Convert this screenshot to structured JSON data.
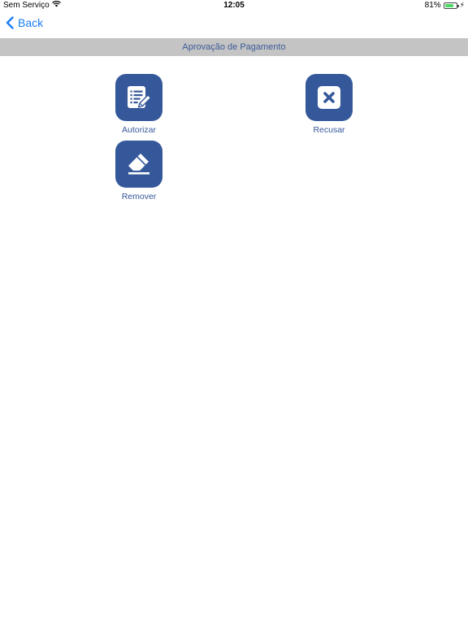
{
  "status_bar": {
    "carrier": "Sem Serviço",
    "time": "12:05",
    "battery_percent": "81%",
    "battery_level": 0.81,
    "battery_color": "#4cd964"
  },
  "nav": {
    "back_label": "Back",
    "accent_color": "#1a7cf3"
  },
  "header": {
    "title": "Aprovação de Pagamento"
  },
  "actions": [
    {
      "label": "Autorizar",
      "icon": "document-edit-icon"
    },
    {
      "label": "Recusar",
      "icon": "close-box-icon"
    },
    {
      "label": "Remover",
      "icon": "eraser-icon"
    }
  ],
  "theme": {
    "tile_color": "#34589a",
    "header_bg": "#c4c4c4"
  }
}
